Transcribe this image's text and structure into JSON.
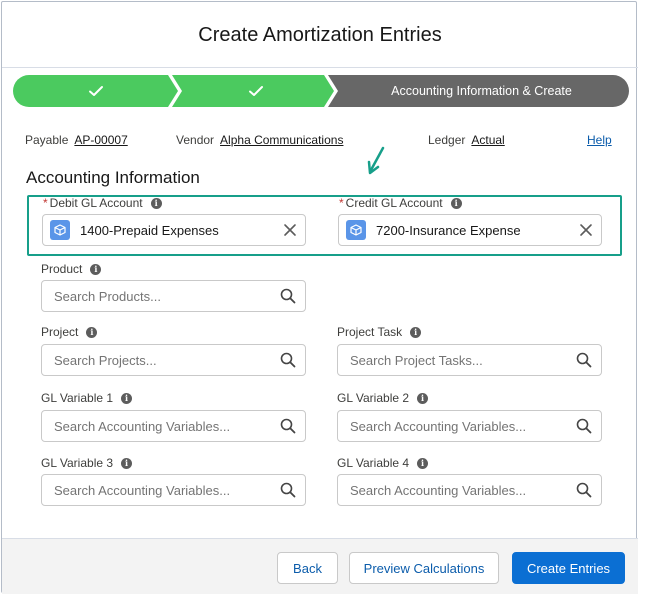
{
  "modal": {
    "title": "Create Amortization Entries"
  },
  "path": {
    "steps": [
      {
        "label": "",
        "status": "complete",
        "icon": "check-icon"
      },
      {
        "label": "",
        "status": "complete",
        "icon": "check-icon"
      },
      {
        "label": "Accounting Information & Create",
        "status": "current"
      }
    ],
    "colors": {
      "complete": "#4bca5f",
      "current": "#676767"
    }
  },
  "meta": {
    "payable_label": "Payable",
    "payable_value": "AP-00007",
    "vendor_label": "Vendor",
    "vendor_value": "Alpha Communications",
    "ledger_label": "Ledger",
    "ledger_value": "Actual",
    "help_label": "Help"
  },
  "section": {
    "title": "Accounting Information"
  },
  "fields": {
    "debit_gl": {
      "required": "*",
      "label": "Debit GL Account",
      "value": "1400-Prepaid Expenses"
    },
    "credit_gl": {
      "required": "*",
      "label": "Credit GL Account",
      "value": "7200-Insurance Expense"
    },
    "product": {
      "label": "Product",
      "placeholder": "Search Products..."
    },
    "project": {
      "label": "Project",
      "placeholder": "Search Projects..."
    },
    "project_task": {
      "label": "Project Task",
      "placeholder": "Search Project Tasks..."
    },
    "gl_var1": {
      "label": "GL Variable 1",
      "placeholder": "Search Accounting Variables..."
    },
    "gl_var2": {
      "label": "GL Variable 2",
      "placeholder": "Search Accounting Variables..."
    },
    "gl_var3": {
      "label": "GL Variable 3",
      "placeholder": "Search Accounting Variables..."
    },
    "gl_var4": {
      "label": "GL Variable 4",
      "placeholder": "Search Accounting Variables..."
    }
  },
  "footer": {
    "back_label": "Back",
    "preview_label": "Preview Calculations",
    "create_label": "Create Entries"
  },
  "annotation_color": "#179f8a"
}
